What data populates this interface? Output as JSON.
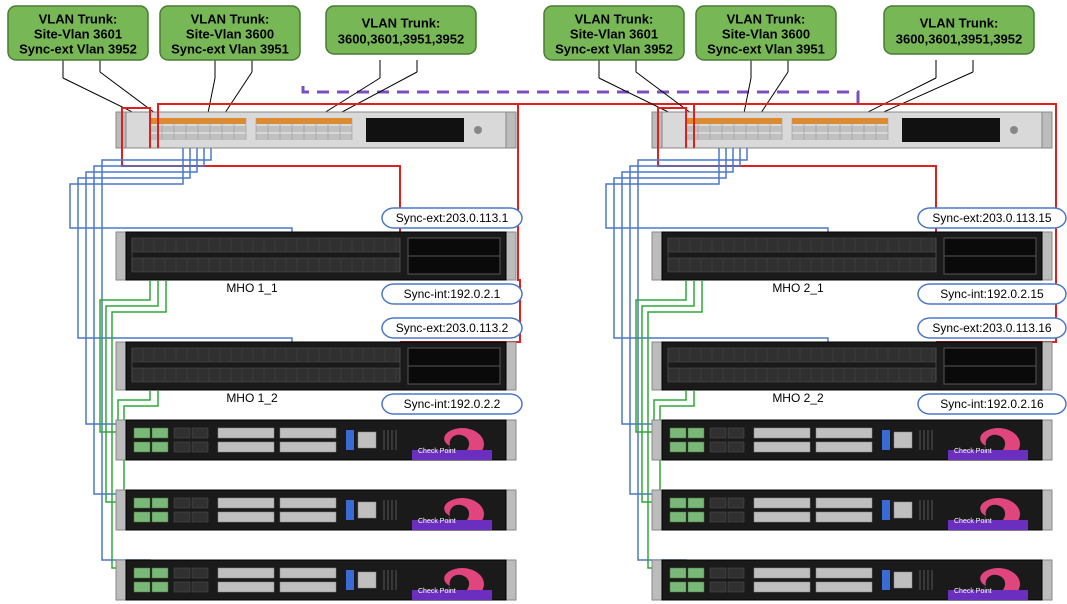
{
  "vlan_boxes": {
    "left": [
      {
        "line1": "VLAN Trunk:",
        "line2": "Site-Vlan 3601",
        "line3": "Sync-ext Vlan 3952"
      },
      {
        "line1": "VLAN Trunk:",
        "line2": "Site-Vlan 3600",
        "line3": "Sync-ext Vlan 3951"
      },
      {
        "line1": "VLAN Trunk:",
        "line2": "3600,3601,3951,3952",
        "line3": ""
      }
    ],
    "right": [
      {
        "line1": "VLAN Trunk:",
        "line2": "Site-Vlan 3601",
        "line3": "Sync-ext Vlan 3952"
      },
      {
        "line1": "VLAN Trunk:",
        "line2": "Site-Vlan 3600",
        "line3": "Sync-ext Vlan 3951"
      },
      {
        "line1": "VLAN Trunk:",
        "line2": "3600,3601,3951,3952",
        "line3": ""
      }
    ]
  },
  "devices": {
    "left": {
      "mho1": "MHO 1_1",
      "mho2": "MHO 1_2",
      "brand": "Check Point"
    },
    "right": {
      "mho1": "MHO 2_1",
      "mho2": "MHO 2_2",
      "brand": "Check Point"
    }
  },
  "ip_labels": {
    "left": [
      "Sync-ext:203.0.113.1",
      "Sync-int:192.0.2.1",
      "Sync-ext:203.0.113.2",
      "Sync-int:192.0.2.2"
    ],
    "right": [
      "Sync-ext:203.0.113.15",
      "Sync-int:192.0.2.15",
      "Sync-ext:203.0.113.16",
      "Sync-int:192.0.2.16"
    ]
  }
}
